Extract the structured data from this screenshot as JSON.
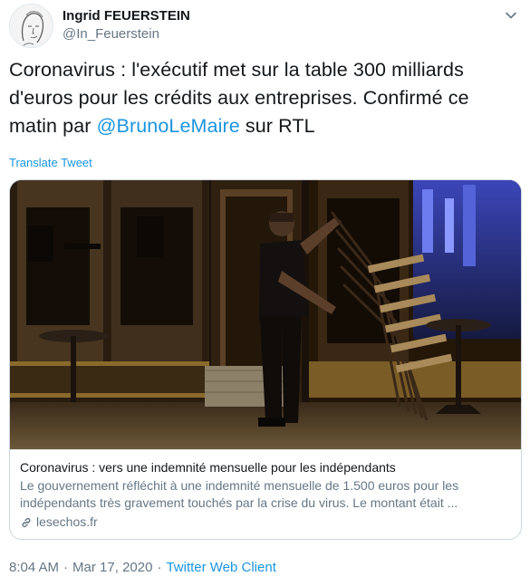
{
  "user": {
    "display_name": "Ingrid FEUERSTEIN",
    "handle": "@In_Feuerstein"
  },
  "tweet": {
    "text_before": "Coronavirus : l'exécutif met sur la table 300 milliards d'euros pour les crédits aux entreprises. Confirmé ce matin par ",
    "mention": "@BrunoLeMaire",
    "text_after": " sur RTL",
    "translate_label": "Translate Tweet"
  },
  "card": {
    "title": "Coronavirus : vers une indemnité mensuelle pour les indépendants",
    "description": "Le gouvernement réfléchit à une indemnité mensuelle de 1.500 euros pour les indépendants très gravement touchés par la crise du virus. Le montant était ...",
    "domain": "lesechos.fr"
  },
  "meta": {
    "time": "8:04 AM",
    "separator": "·",
    "date": "Mar 17, 2020",
    "client": "Twitter Web Client"
  },
  "icons": {
    "menu": "chevron-down-icon",
    "link": "link-icon"
  },
  "colors": {
    "link_blue": "#1b95e0",
    "text": "#14171a",
    "secondary": "#657786",
    "border": "#ccd6dd"
  }
}
